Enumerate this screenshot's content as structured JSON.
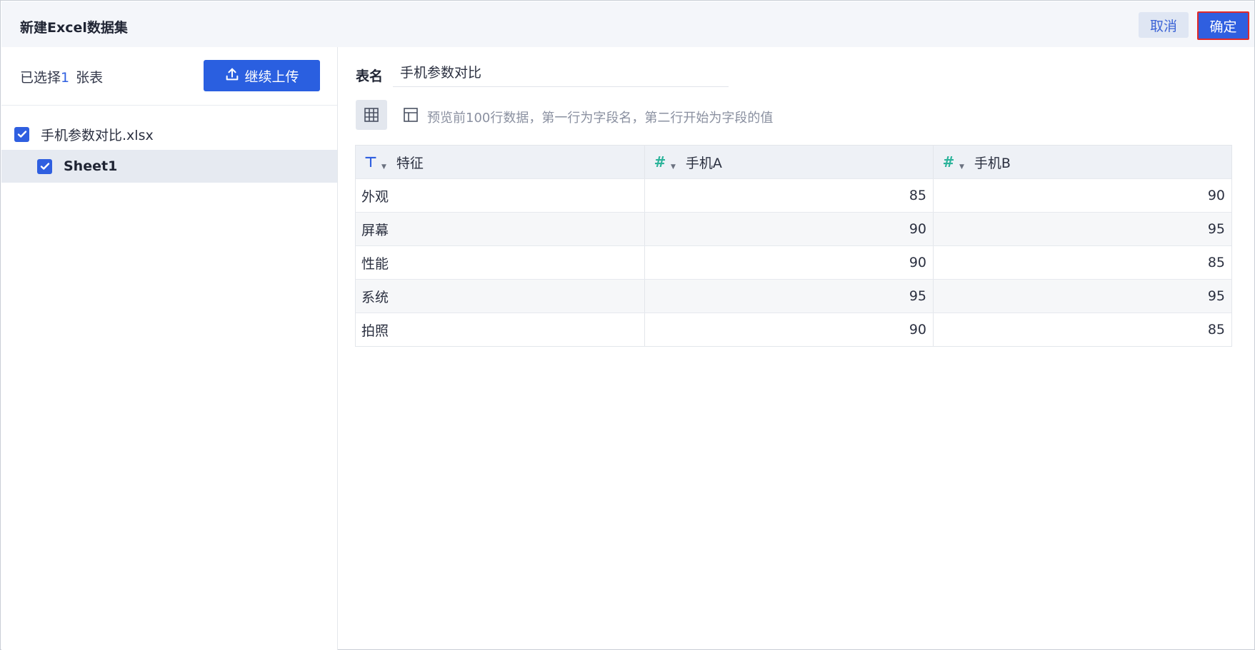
{
  "dialog": {
    "title": "新建Excel数据集",
    "cancel_label": "取消",
    "confirm_label": "确定"
  },
  "left_panel": {
    "selected_prefix": "已选择",
    "selected_count": "1",
    "selected_suffix": "张表",
    "upload_button": "继续上传",
    "file_name": "手机参数对比.xlsx",
    "sheet_name": "Sheet1"
  },
  "right_panel": {
    "name_label": "表名",
    "name_value": "手机参数对比",
    "hint": "预览前100行数据，第一行为字段名，第二行开始为字段的值"
  },
  "table": {
    "columns": [
      {
        "name": "特征",
        "type_icon": "text-type-icon",
        "glyph": "⊤"
      },
      {
        "name": "手机A",
        "type_icon": "number-type-icon",
        "glyph": "#"
      },
      {
        "name": "手机B",
        "type_icon": "number-type-icon",
        "glyph": "#"
      }
    ],
    "rows": [
      [
        "外观",
        "85",
        "90"
      ],
      [
        "屏幕",
        "90",
        "95"
      ],
      [
        "性能",
        "90",
        "85"
      ],
      [
        "系统",
        "95",
        "95"
      ],
      [
        "拍照",
        "90",
        "85"
      ]
    ]
  },
  "colors": {
    "primary": "#2f5fe0",
    "confirm_border": "#e02a2a",
    "number_type": "#2bb39a"
  }
}
